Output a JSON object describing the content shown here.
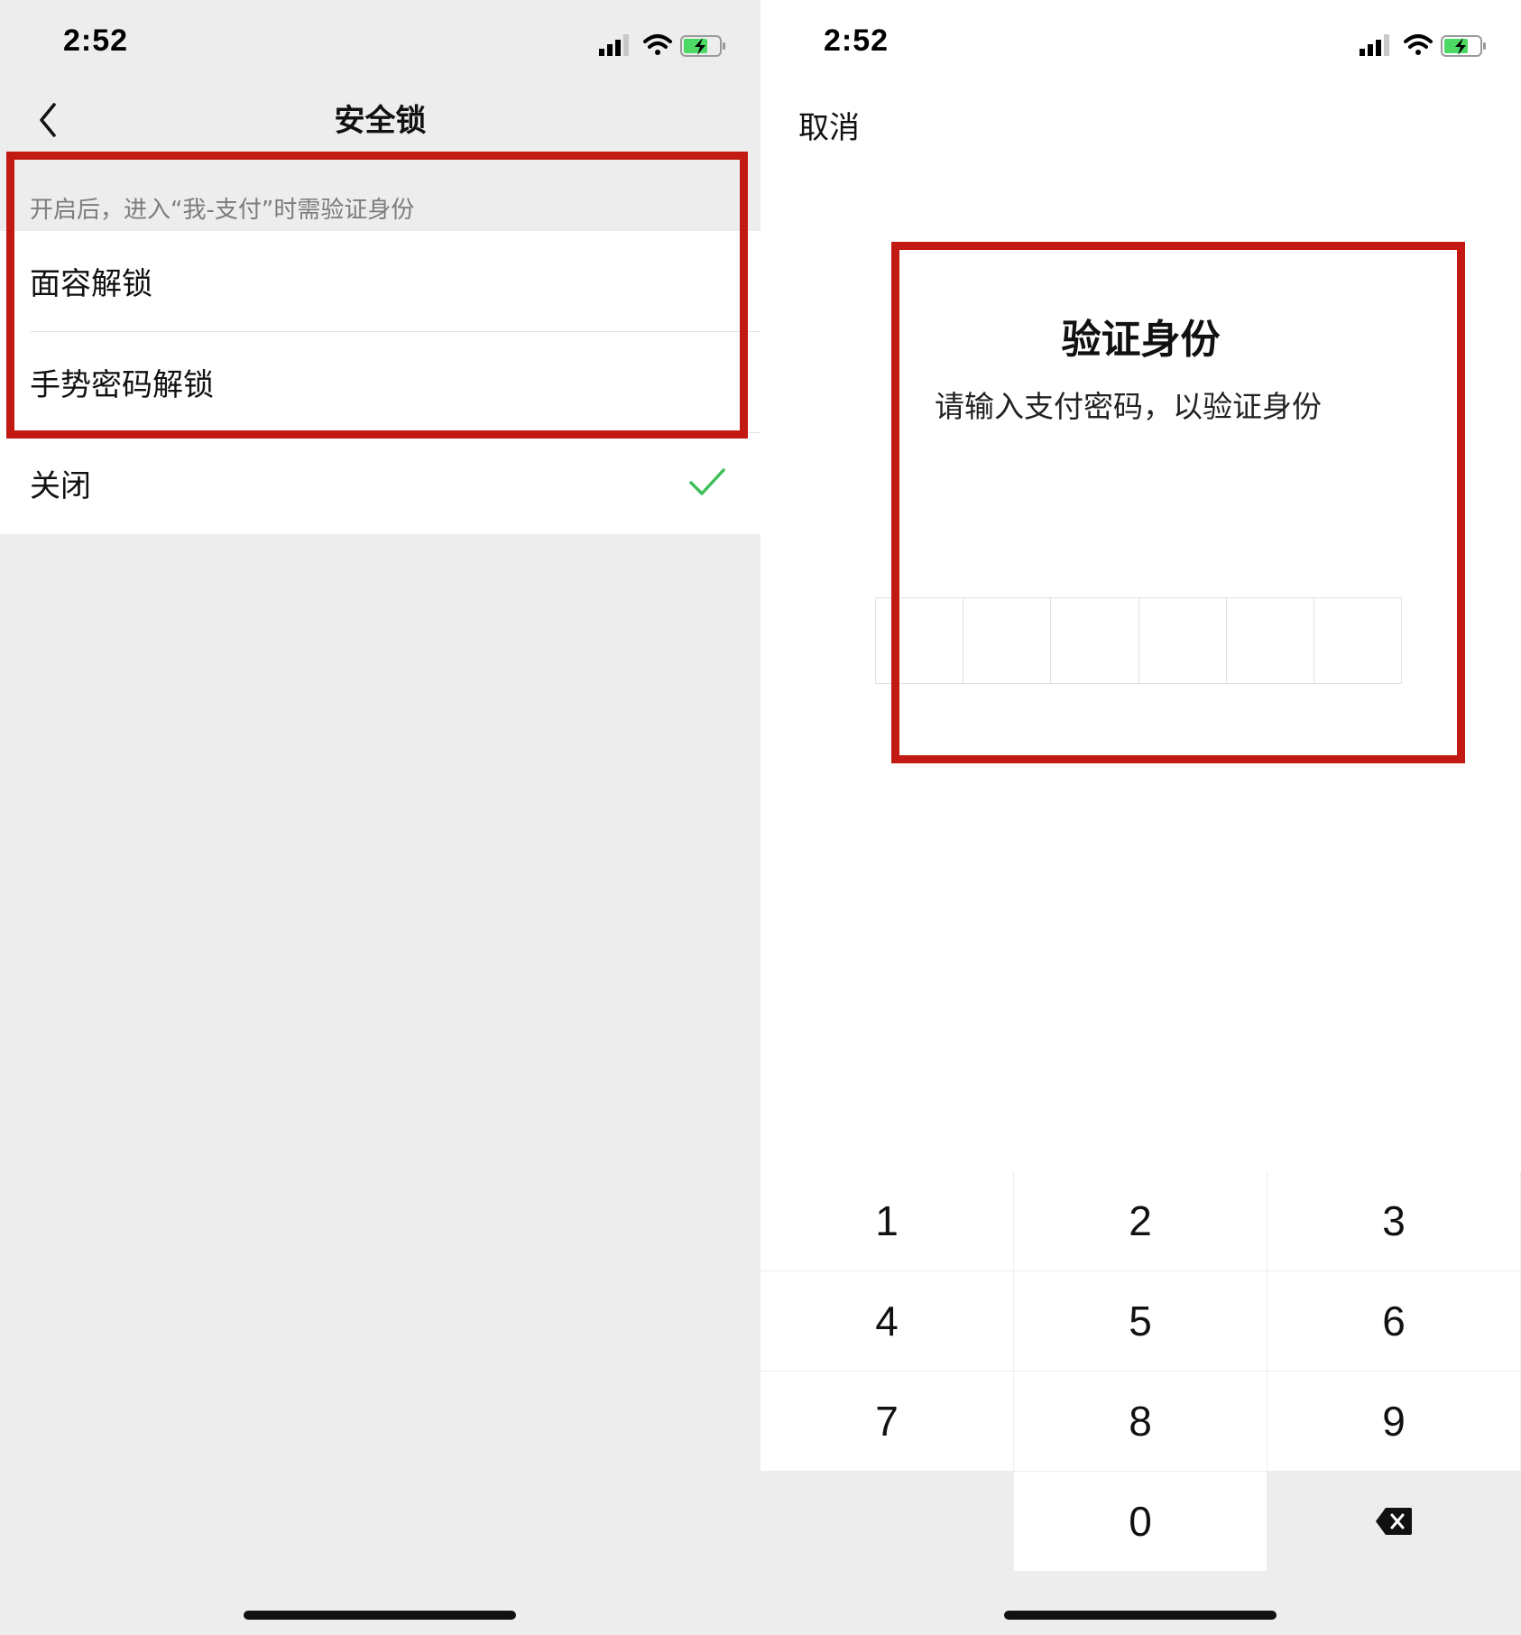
{
  "left": {
    "status": {
      "time": "2:52"
    },
    "nav": {
      "title": "安全锁"
    },
    "hint": "开启后，进入“我-支付”时需验证身份",
    "options": [
      {
        "label": "面容解锁",
        "selected": false
      },
      {
        "label": "手势密码解锁",
        "selected": false
      },
      {
        "label": "关闭",
        "selected": true
      }
    ]
  },
  "right": {
    "status": {
      "time": "2:52"
    },
    "cancel_label": "取消",
    "title": "验证身份",
    "subtitle": "请输入支付密码，以验证身份",
    "pin_length": 6,
    "keypad": {
      "rows": [
        [
          "1",
          "2",
          "3"
        ],
        [
          "4",
          "5",
          "6"
        ],
        [
          "7",
          "8",
          "9"
        ],
        [
          "",
          "0",
          "delete-icon"
        ]
      ]
    }
  },
  "colors": {
    "highlight": "#c21a12",
    "check": "#3fbf5a",
    "battery": "#4cd964",
    "background_grey": "#ededed"
  }
}
